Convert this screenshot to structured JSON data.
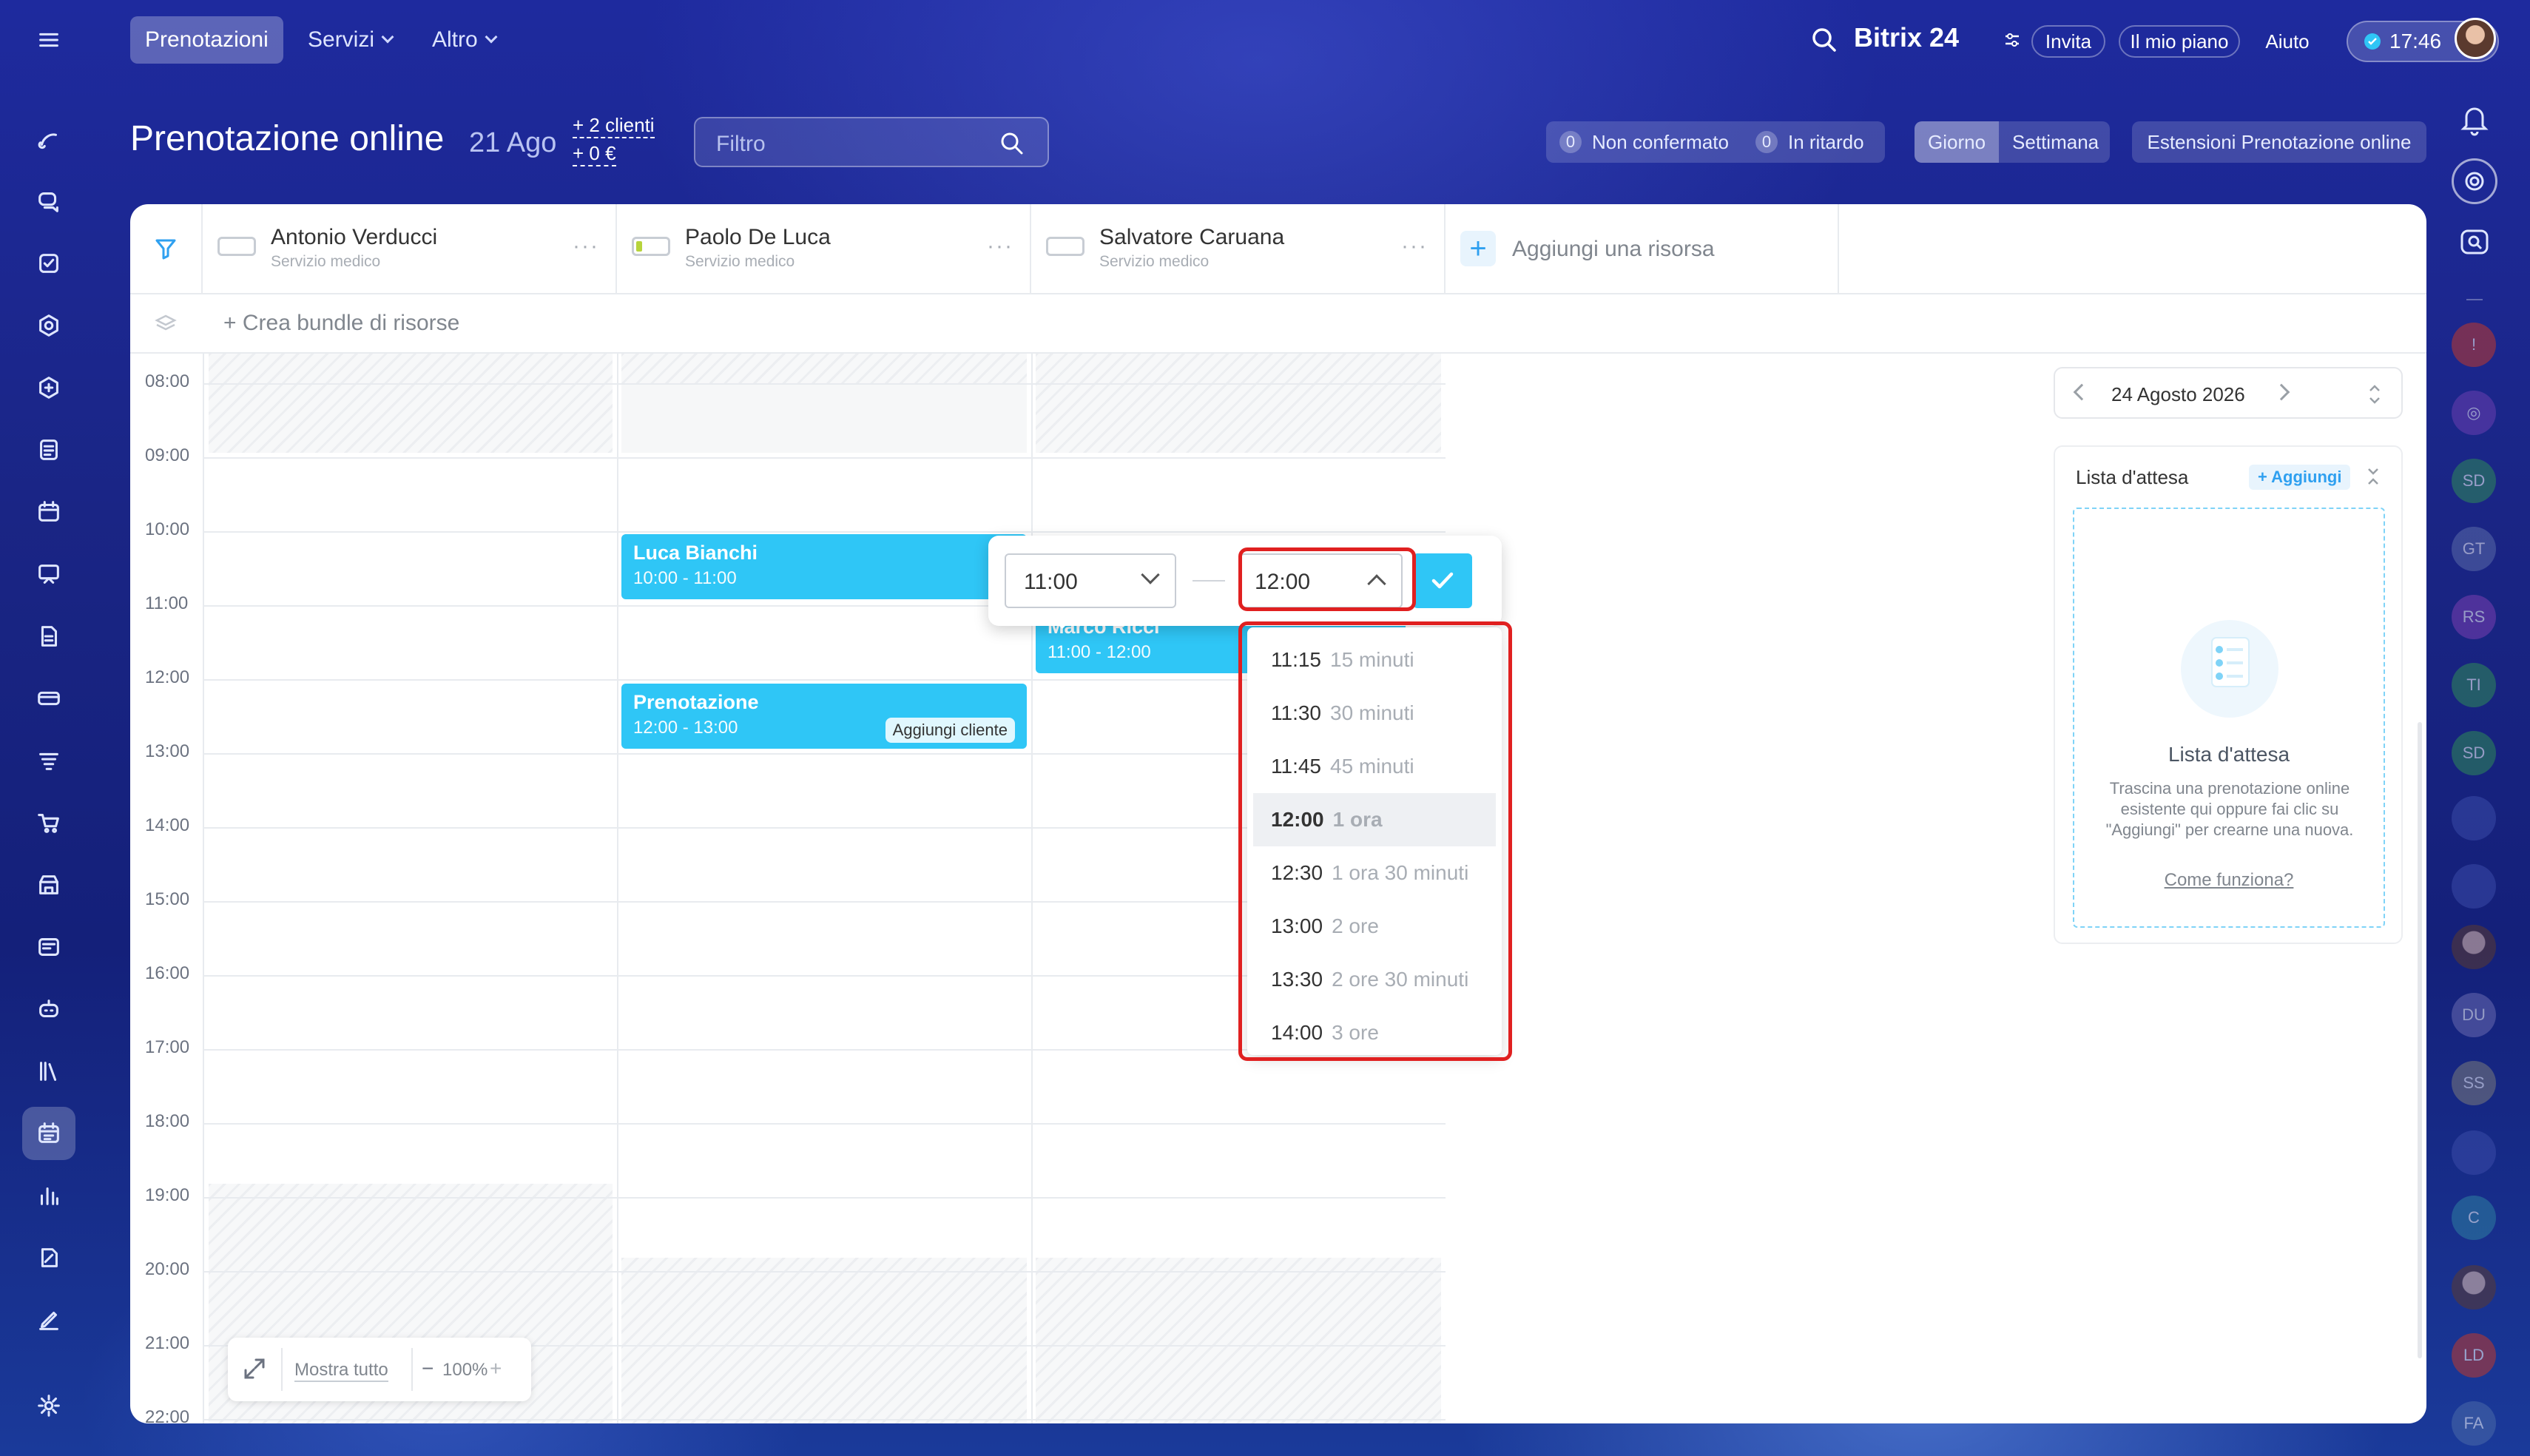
{
  "header": {
    "tabs": [
      {
        "label": "Prenotazioni",
        "active": true
      },
      {
        "label": "Servizi"
      },
      {
        "label": "Altro"
      }
    ],
    "brand": "Bitrix 24",
    "invite_label": "Invita",
    "plan_label": "Il mio piano",
    "help_label": "Aiuto",
    "clock": "17:46"
  },
  "page": {
    "title": "Prenotazione online",
    "date": "21 Ago",
    "clients_link": "+ 2 clienti",
    "amount_link": "+ 0 €",
    "filter_placeholder": "Filtro",
    "unconfirmed_count": "0",
    "unconfirmed_label": "Non confermato",
    "late_count": "0",
    "late_label": "In ritardo",
    "view_day": "Giorno",
    "view_week": "Settimana",
    "extensions_label": "Estensioni Prenotazione online"
  },
  "resources": [
    {
      "name": "Antonio Verducci",
      "service": "Servizio medico"
    },
    {
      "name": "Paolo De Luca",
      "service": "Servizio medico"
    },
    {
      "name": "Salvatore Caruana",
      "service": "Servizio medico"
    }
  ],
  "add_resource_label": "Aggiungi una risorsa",
  "bundle_label": "+ Crea bundle di risorse",
  "hours": [
    "08:00",
    "09:00",
    "10:00",
    "11:00",
    "12:00",
    "13:00",
    "14:00",
    "15:00",
    "16:00",
    "17:00",
    "18:00",
    "19:00",
    "20:00",
    "21:00",
    "22:00"
  ],
  "bookings": [
    {
      "title": "Luca Bianchi",
      "time": "10:00 - 11:00"
    },
    {
      "title": "Marco Ricci",
      "time": "11:00 - 12:00"
    },
    {
      "title": "Prenotazione",
      "time": "12:00 - 13:00",
      "action": "Aggiungi cliente"
    }
  ],
  "time_edit": {
    "start": "11:00",
    "end": "12:00",
    "options": [
      {
        "time": "11:15",
        "duration": "15 minuti"
      },
      {
        "time": "11:30",
        "duration": "30 minuti"
      },
      {
        "time": "11:45",
        "duration": "45 minuti"
      },
      {
        "time": "12:00",
        "duration": "1 ora",
        "selected": true
      },
      {
        "time": "12:30",
        "duration": "1 ora 30 minuti"
      },
      {
        "time": "13:00",
        "duration": "2 ore"
      },
      {
        "time": "13:30",
        "duration": "2 ore 30 minuti"
      },
      {
        "time": "14:00",
        "duration": "3 ore"
      }
    ]
  },
  "zoom": {
    "show_all": "Mostra tutto",
    "level": "100%"
  },
  "side_panel": {
    "date": "24 Agosto 2026",
    "waitlist_title": "Lista d'attesa",
    "add_label": "+ Aggiungi",
    "empty_title": "Lista d'attesa",
    "empty_text": "Trascina una prenotazione online esistente qui oppure fai clic su \"Aggiungi\" per crearne una nuova.",
    "how_link": "Come funziona?"
  },
  "right_rail_initials": [
    "SD",
    "GT",
    "RS",
    "TI",
    "SD",
    "DU",
    "SS",
    "C",
    "LD",
    "FA"
  ],
  "colors": {
    "accent": "#2fc6f6",
    "highlight": "#e02020"
  }
}
